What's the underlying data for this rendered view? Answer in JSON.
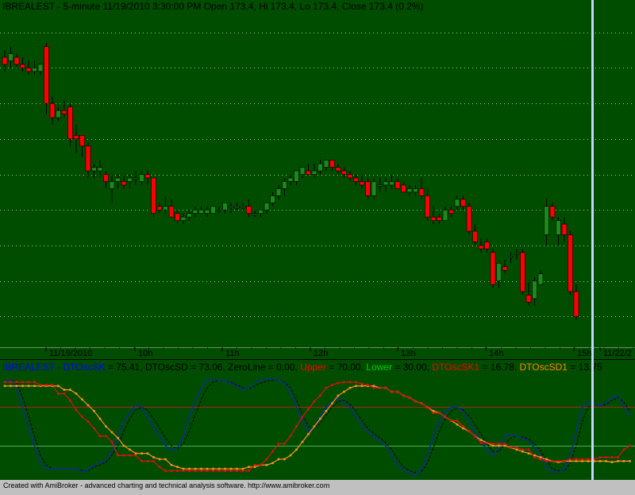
{
  "price_panel": {
    "header": "IBREALEST - 5-minute 11/19/2010 3:30:00 PM Open 173.4, Hi 173.4, Lo 173.4, Close 173.4 (0.2%)"
  },
  "time_axis": {
    "labels": [
      "11/19/2010",
      "10h",
      "11h",
      "12h",
      "13h",
      "14h",
      "15h",
      "11/22/2"
    ]
  },
  "indicator_panel": {
    "legend": [
      {
        "text": "IBREALEST - ",
        "color": "#0000ff"
      },
      {
        "text": "DTOscSK",
        "color": "#0000ff"
      },
      {
        "text": " = 75.41, DTOscSD = 73.06, ZeroLine = 0.00, ",
        "color": "#000000"
      },
      {
        "text": "Upper",
        "color": "#ff0000"
      },
      {
        "text": " = 70.00, ",
        "color": "#000000"
      },
      {
        "text": "Lower",
        "color": "#00cc00"
      },
      {
        "text": " = 30.00, ",
        "color": "#000000"
      },
      {
        "text": "DTOscSK1",
        "color": "#ff0000"
      },
      {
        "text": " = 16.78, ",
        "color": "#000000"
      },
      {
        "text": "DTOscSD1",
        "color": "#ff8800"
      },
      {
        "text": " = 13.75",
        "color": "#000000"
      }
    ]
  },
  "footer": {
    "text": "Created with AmiBroker - advanced charting and technical analysis software. http://www.amibroker.com"
  },
  "colors": {
    "background": "#004d00",
    "up_candle": "#1a8a1a",
    "down_candle": "#ff0000",
    "cursor": "#c8d4ff",
    "dtosc_sk": "#0b2f8a",
    "dtosc_sd": "#000000",
    "upper": "#b02020",
    "lower": "#4caf50",
    "dtosc_sk1": "#e01010",
    "dtosc_sd1": "#ff9020"
  },
  "chart_data": [
    {
      "type": "candlestick",
      "ylim": [
        168.2,
        177.6
      ],
      "grid": true,
      "ohlc": [
        [
          176.3,
          176.5,
          175.9,
          176.1
        ],
        [
          176.2,
          176.6,
          176.0,
          176.4
        ],
        [
          176.3,
          176.4,
          176.0,
          176.1
        ],
        [
          176.1,
          176.3,
          175.9,
          176.0
        ],
        [
          176.0,
          176.2,
          175.8,
          175.9
        ],
        [
          175.9,
          176.2,
          175.8,
          176.0
        ],
        [
          175.9,
          176.1,
          175.8,
          176.1
        ],
        [
          176.6,
          176.7,
          174.7,
          175.0
        ],
        [
          175.0,
          175.2,
          174.4,
          174.6
        ],
        [
          174.6,
          174.9,
          174.5,
          174.8
        ],
        [
          174.8,
          175.1,
          174.6,
          174.7
        ],
        [
          174.9,
          175.0,
          173.8,
          174.0
        ],
        [
          174.1,
          174.4,
          173.6,
          174.0
        ],
        [
          174.1,
          174.1,
          173.5,
          173.8
        ],
        [
          173.8,
          173.9,
          172.9,
          173.1
        ],
        [
          173.1,
          173.3,
          172.9,
          173.2
        ],
        [
          173.1,
          173.4,
          172.9,
          173.2
        ],
        [
          173.0,
          173.1,
          172.6,
          172.8
        ],
        [
          172.6,
          173.0,
          172.2,
          172.8
        ],
        [
          172.8,
          173.0,
          172.6,
          172.9
        ],
        [
          172.8,
          173.0,
          172.6,
          172.7
        ],
        [
          172.8,
          173.0,
          172.6,
          172.9
        ],
        [
          172.9,
          173.1,
          172.7,
          172.9
        ],
        [
          172.8,
          173.1,
          172.7,
          173.0
        ],
        [
          173.0,
          173.1,
          172.7,
          172.9
        ],
        [
          172.9,
          172.9,
          171.8,
          171.9
        ],
        [
          172.1,
          172.2,
          171.9,
          172.0
        ],
        [
          172.0,
          172.4,
          171.9,
          172.1
        ],
        [
          172.1,
          172.3,
          171.8,
          171.8
        ],
        [
          171.9,
          172.0,
          171.6,
          171.7
        ],
        [
          171.7,
          171.9,
          171.6,
          171.8
        ],
        [
          171.8,
          172.0,
          171.7,
          171.9
        ],
        [
          171.9,
          172.1,
          171.8,
          172.0
        ],
        [
          171.9,
          172.1,
          171.9,
          172.0
        ],
        [
          171.9,
          172.1,
          171.8,
          172.0
        ],
        [
          171.9,
          172.1,
          171.9,
          172.1
        ],
        [
          172.0,
          172.1,
          171.9,
          172.0
        ],
        [
          172.0,
          172.2,
          171.9,
          172.2
        ],
        [
          172.1,
          172.2,
          171.9,
          172.1
        ],
        [
          172.1,
          172.2,
          172.0,
          172.1
        ],
        [
          172.1,
          172.2,
          172.0,
          172.1
        ],
        [
          172.1,
          172.3,
          171.8,
          171.9
        ],
        [
          171.9,
          172.0,
          171.8,
          171.9
        ],
        [
          171.9,
          172.0,
          171.8,
          172.0
        ],
        [
          172.0,
          172.2,
          171.9,
          172.2
        ],
        [
          172.2,
          172.5,
          172.1,
          172.4
        ],
        [
          172.4,
          172.7,
          172.3,
          172.6
        ],
        [
          172.6,
          172.9,
          172.4,
          172.8
        ],
        [
          172.8,
          173.0,
          172.7,
          172.9
        ],
        [
          172.8,
          173.1,
          172.7,
          173.1
        ],
        [
          173.0,
          173.2,
          172.9,
          173.2
        ],
        [
          173.1,
          173.3,
          173.0,
          173.0
        ],
        [
          173.0,
          173.3,
          172.9,
          173.1
        ],
        [
          173.1,
          173.4,
          173.0,
          173.3
        ],
        [
          173.2,
          173.4,
          173.1,
          173.4
        ],
        [
          173.4,
          173.4,
          173.1,
          173.2
        ],
        [
          173.2,
          173.3,
          173.0,
          173.1
        ],
        [
          173.1,
          173.2,
          172.9,
          173.0
        ],
        [
          173.0,
          173.1,
          172.8,
          172.9
        ],
        [
          172.9,
          173.0,
          172.7,
          172.8
        ],
        [
          172.8,
          173.0,
          172.6,
          172.7
        ],
        [
          172.8,
          172.9,
          172.3,
          172.4
        ],
        [
          172.4,
          172.9,
          172.3,
          172.8
        ],
        [
          172.7,
          172.9,
          172.5,
          172.7
        ],
        [
          172.7,
          172.9,
          172.5,
          172.8
        ],
        [
          172.7,
          173.0,
          172.6,
          172.8
        ],
        [
          172.8,
          172.9,
          172.6,
          172.6
        ],
        [
          172.7,
          172.8,
          172.5,
          172.5
        ],
        [
          172.5,
          172.7,
          172.4,
          172.6
        ],
        [
          172.5,
          172.7,
          172.4,
          172.6
        ],
        [
          172.6,
          172.9,
          172.3,
          172.4
        ],
        [
          172.4,
          172.6,
          171.7,
          171.8
        ],
        [
          171.8,
          172.1,
          171.6,
          171.7
        ],
        [
          171.8,
          171.9,
          171.6,
          171.7
        ],
        [
          171.7,
          172.1,
          171.7,
          172.0
        ],
        [
          172.0,
          172.1,
          171.8,
          171.9
        ],
        [
          172.1,
          172.4,
          172.0,
          172.3
        ],
        [
          172.3,
          172.4,
          172.0,
          172.1
        ],
        [
          172.1,
          172.2,
          171.3,
          171.4
        ],
        [
          171.4,
          171.6,
          171.0,
          171.1
        ],
        [
          171.0,
          171.2,
          170.8,
          170.9
        ],
        [
          171.1,
          171.2,
          170.8,
          170.9
        ],
        [
          170.8,
          170.9,
          169.8,
          169.9
        ],
        [
          170.0,
          170.5,
          169.8,
          170.5
        ],
        [
          170.4,
          170.6,
          170.2,
          170.3
        ],
        [
          170.7,
          170.8,
          170.5,
          170.7
        ],
        [
          170.8,
          170.9,
          170.6,
          170.8
        ],
        [
          170.8,
          170.9,
          169.6,
          169.7
        ],
        [
          169.6,
          170.0,
          169.3,
          169.4
        ],
        [
          169.5,
          170.1,
          169.3,
          170.0
        ],
        [
          169.9,
          170.3,
          169.9,
          170.2
        ],
        [
          171.3,
          172.3,
          171.0,
          172.1
        ],
        [
          172.1,
          172.2,
          171.7,
          171.8
        ],
        [
          171.3,
          171.8,
          171.0,
          171.7
        ],
        [
          171.6,
          171.8,
          171.1,
          171.3
        ],
        [
          171.3,
          171.4,
          169.6,
          169.7
        ],
        [
          169.7,
          169.9,
          168.9,
          169.0
        ]
      ]
    },
    {
      "type": "line",
      "ylim": [
        -3,
        105
      ],
      "series": [
        {
          "name": "DTOscSK",
          "values": [
            98,
            98,
            90,
            70,
            50,
            30,
            12,
            6,
            6,
            6,
            6,
            6,
            5,
            3,
            5,
            10,
            12,
            15,
            25,
            40,
            55,
            65,
            72,
            70,
            60,
            50,
            40,
            30,
            25,
            28,
            40,
            60,
            75,
            90,
            98,
            99,
            98,
            97,
            95,
            92,
            88,
            90,
            95,
            98,
            99,
            99,
            98,
            95,
            85,
            70,
            55,
            45,
            50,
            60,
            70,
            75,
            80,
            75,
            70,
            60,
            50,
            45,
            40,
            35,
            30,
            20,
            10,
            5,
            2,
            0,
            5,
            20,
            40,
            55,
            65,
            70,
            70,
            65,
            55,
            45,
            35,
            25,
            20,
            28,
            40,
            42,
            40,
            38,
            35,
            28,
            20,
            8,
            3,
            3,
            5,
            20,
            45,
            70,
            75,
            73,
            72,
            75,
            80,
            82,
            70,
            60
          ]
        },
        {
          "name": "DTOscSD",
          "values": [
            98,
            98,
            95,
            80,
            60,
            40,
            20,
            10,
            6,
            6,
            6,
            6,
            5,
            4,
            4,
            8,
            10,
            13,
            20,
            30,
            45,
            58,
            67,
            70,
            67,
            58,
            48,
            38,
            30,
            27,
            32,
            45,
            62,
            78,
            90,
            96,
            98,
            97,
            96,
            93,
            90,
            89,
            92,
            95,
            97,
            98,
            98,
            96,
            90,
            78,
            62,
            50,
            48,
            53,
            62,
            70,
            76,
            77,
            73,
            66,
            56,
            48,
            43,
            38,
            33,
            26,
            16,
            8,
            4,
            2,
            3,
            12,
            28,
            45,
            58,
            66,
            69,
            67,
            61,
            52,
            42,
            32,
            24,
            24,
            32,
            38,
            40,
            39,
            37,
            32,
            25,
            15,
            6,
            4,
            4,
            12,
            30,
            55,
            70,
            73,
            72,
            73,
            77,
            80,
            75,
            66
          ]
        },
        {
          "name": "DTOscSK1",
          "values": [
            96,
            96,
            96,
            96,
            96,
            96,
            93,
            93,
            93,
            84,
            84,
            77,
            67,
            60,
            55,
            48,
            40,
            40,
            34,
            20,
            20,
            20,
            20,
            14,
            14,
            14,
            8,
            4,
            4,
            4,
            4,
            4,
            4,
            4,
            4,
            4,
            4,
            4,
            4,
            4,
            4,
            4,
            10,
            10,
            16,
            24,
            32,
            32,
            40,
            50,
            60,
            68,
            76,
            82,
            90,
            93,
            95,
            96,
            96,
            96,
            94,
            93,
            90,
            90,
            90,
            86,
            86,
            82,
            80,
            76,
            74,
            70,
            64,
            64,
            60,
            56,
            56,
            50,
            45,
            40,
            33,
            33,
            32,
            32,
            32,
            28,
            28,
            26,
            26,
            18,
            16,
            14,
            14,
            14,
            14,
            16,
            16,
            16,
            16,
            16,
            18,
            18,
            18,
            18,
            26,
            30
          ]
        },
        {
          "name": "DTOscSD1",
          "values": [
            92,
            92,
            92,
            92,
            92,
            92,
            92,
            92,
            92,
            92,
            88,
            88,
            84,
            78,
            72,
            66,
            58,
            50,
            44,
            38,
            30,
            26,
            22,
            22,
            22,
            18,
            16,
            16,
            10,
            8,
            6,
            6,
            6,
            6,
            6,
            6,
            6,
            6,
            6,
            6,
            6,
            8,
            8,
            10,
            10,
            12,
            16,
            16,
            20,
            26,
            34,
            42,
            50,
            58,
            66,
            74,
            82,
            86,
            90,
            92,
            92,
            92,
            92,
            90,
            90,
            86,
            86,
            82,
            80,
            76,
            74,
            70,
            66,
            64,
            60,
            56,
            52,
            48,
            45,
            40,
            36,
            33,
            30,
            30,
            30,
            28,
            26,
            24,
            22,
            20,
            18,
            16,
            14,
            13,
            14,
            14,
            14,
            14,
            14,
            14,
            14,
            14,
            13,
            14,
            14,
            14
          ]
        },
        {
          "name": "Upper",
          "values": [
            70,
            70
          ]
        },
        {
          "name": "Lower",
          "values": [
            30,
            30
          ]
        },
        {
          "name": "ZeroLine",
          "values": [
            0,
            0
          ]
        }
      ]
    }
  ]
}
